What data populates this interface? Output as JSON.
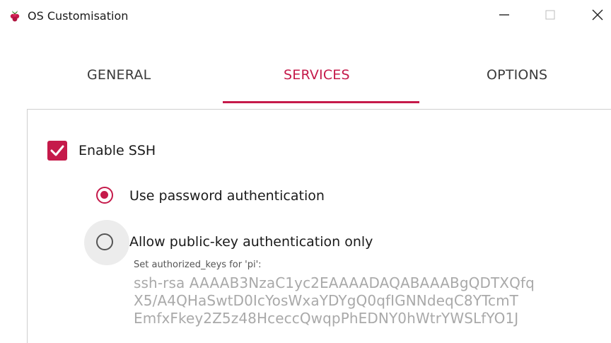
{
  "window": {
    "title": "OS Customisation",
    "controls": {
      "minimize_icon": "minimize-icon",
      "maximize_icon": "maximize-icon",
      "close_icon": "close-icon"
    }
  },
  "tabs": [
    {
      "label": "GENERAL",
      "active": false
    },
    {
      "label": "SERVICES",
      "active": true
    },
    {
      "label": "OPTIONS",
      "active": false
    }
  ],
  "services": {
    "ssh_checkbox": {
      "label": "Enable SSH",
      "checked": true
    },
    "auth_options": [
      {
        "label": "Use password authentication",
        "selected": true
      },
      {
        "label": "Allow public-key authentication only",
        "selected": false
      }
    ],
    "authorized_keys": {
      "caption": "Set authorized_keys for 'pi':",
      "lines": [
        "ssh-rsa AAAAB3NzaC1yc2EAAAADAQABAAABgQDTXQfq",
        "X5/A4QHaSwtD0IcYosWxaYDYgQ0qfIGNNdeqC8YTcmT",
        "EmfxFkey2Z5z48HceccQwqpPhEDNY0hWtrYWSLfYO1J"
      ]
    }
  },
  "colors": {
    "accent": "#c51a4a",
    "disabled_text": "#a9a9a9"
  }
}
